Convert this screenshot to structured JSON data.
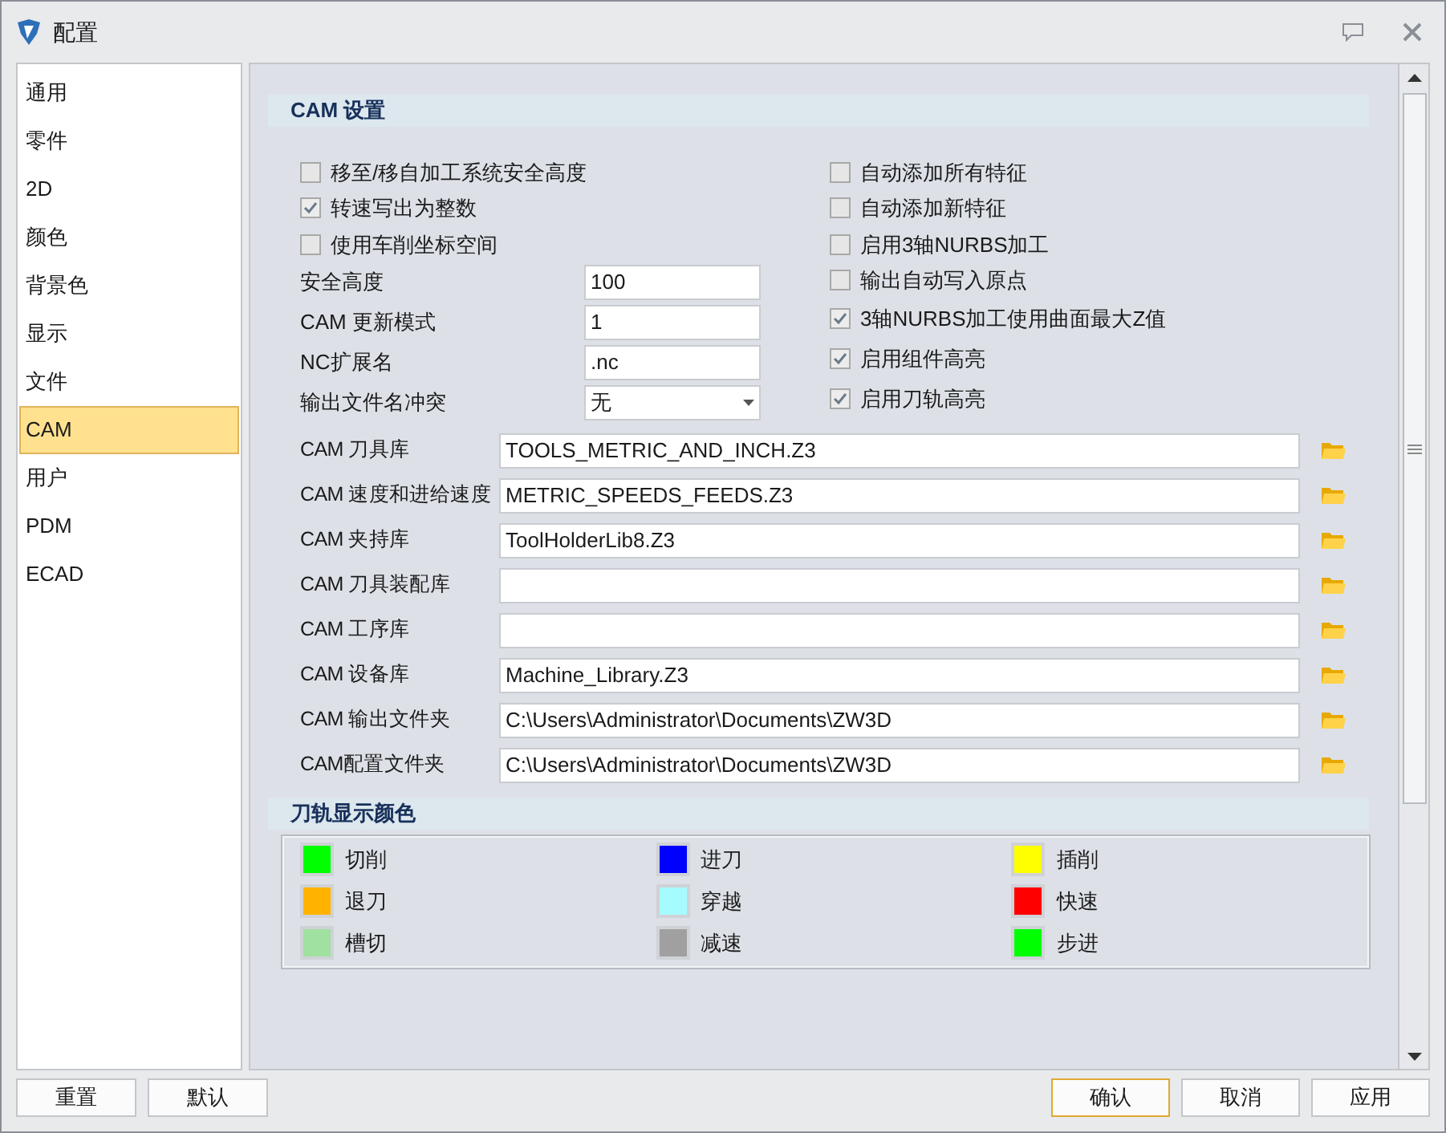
{
  "window": {
    "title": "配置"
  },
  "sidebar": {
    "items": [
      {
        "label": "通用",
        "selected": false
      },
      {
        "label": "零件",
        "selected": false
      },
      {
        "label": "2D",
        "selected": false
      },
      {
        "label": "颜色",
        "selected": false
      },
      {
        "label": "背景色",
        "selected": false
      },
      {
        "label": "显示",
        "selected": false
      },
      {
        "label": "文件",
        "selected": false
      },
      {
        "label": "CAM",
        "selected": true
      },
      {
        "label": "用户",
        "selected": false
      },
      {
        "label": "PDM",
        "selected": false
      },
      {
        "label": "ECAD",
        "selected": false
      }
    ]
  },
  "cam_settings": {
    "title": "CAM 设置",
    "left_checkboxes": [
      {
        "label": "移至/移自加工系统安全高度",
        "checked": false
      },
      {
        "label": "转速写出为整数",
        "checked": true
      },
      {
        "label": "使用车削坐标空间",
        "checked": false
      }
    ],
    "fields": [
      {
        "label": "安全高度",
        "value": "100",
        "kind": "text"
      },
      {
        "label": "CAM 更新模式",
        "value": "1",
        "kind": "text"
      },
      {
        "label": "NC扩展名",
        "value": ".nc",
        "kind": "text"
      },
      {
        "label": "输出文件名冲突",
        "value": "无",
        "kind": "dropdown"
      }
    ],
    "right_checkboxes": [
      {
        "label": "自动添加所有特征",
        "checked": false
      },
      {
        "label": "自动添加新特征",
        "checked": false
      },
      {
        "label": "启用3轴NURBS加工",
        "checked": false
      },
      {
        "label": "输出自动写入原点",
        "checked": false
      },
      {
        "label": "3轴NURBS加工使用曲面最大Z值",
        "checked": true
      },
      {
        "label": "启用组件高亮",
        "checked": true
      },
      {
        "label": "启用刀轨高亮",
        "checked": true
      }
    ],
    "paths": [
      {
        "label": "CAM 刀具库",
        "value": "TOOLS_METRIC_AND_INCH.Z3"
      },
      {
        "label": "CAM 速度和进给速度",
        "value": "METRIC_SPEEDS_FEEDS.Z3"
      },
      {
        "label": "CAM 夹持库",
        "value": "ToolHolderLib8.Z3"
      },
      {
        "label": "CAM 刀具装配库"
      },
      {
        "label": "CAM 工序库"
      },
      {
        "label": "CAM 设备库",
        "value": "Machine_Library.Z3"
      },
      {
        "label": "CAM 输出文件夹",
        "value": "C:\\Users\\Administrator\\Documents\\ZW3D"
      },
      {
        "label": "CAM配置文件夹",
        "value": "C:\\Users\\Administrator\\Documents\\ZW3D"
      }
    ]
  },
  "toolpath_colors": {
    "title": "刀轨显示颜色",
    "items": [
      {
        "label": "切削",
        "color": "#00ff00"
      },
      {
        "label": "进刀",
        "color": "#0000ff"
      },
      {
        "label": "插削",
        "color": "#ffff00"
      },
      {
        "label": "退刀",
        "color": "#ffb300"
      },
      {
        "label": "穿越",
        "color": "#a6fbff"
      },
      {
        "label": "快速",
        "color": "#ff0000"
      },
      {
        "label": "槽切",
        "color": "#a0e0a0"
      },
      {
        "label": "减速",
        "color": "#a0a0a0"
      },
      {
        "label": "步进",
        "color": "#00ff00"
      }
    ]
  },
  "left_buttons": [
    {
      "label": "重置"
    },
    {
      "label": "默认"
    }
  ],
  "right_buttons": [
    {
      "label": "确认",
      "default": true
    },
    {
      "label": "取消",
      "default": false
    },
    {
      "label": "应用",
      "default": false
    }
  ]
}
